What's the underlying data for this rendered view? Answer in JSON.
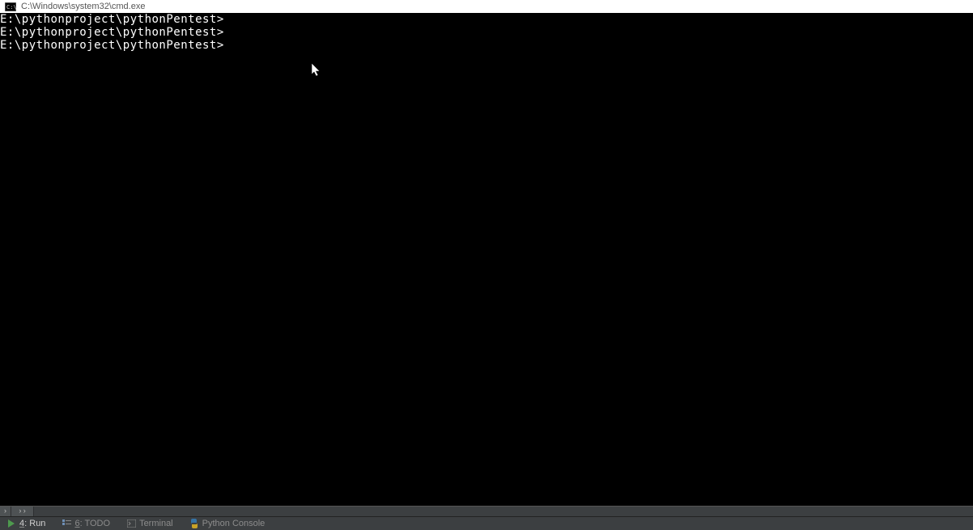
{
  "titlebar": {
    "title": "C:\\Windows\\system32\\cmd.exe"
  },
  "terminal": {
    "lines": [
      "E:\\pythonproject\\pythonPentest>",
      "E:\\pythonproject\\pythonPentest>",
      "E:\\pythonproject\\pythonPentest>"
    ]
  },
  "tabstrip": {
    "collapse1": "›",
    "collapse2": "››"
  },
  "bottombar": {
    "run": {
      "num": "4",
      "label": "Run"
    },
    "todo": {
      "num": "6",
      "label": "TODO"
    },
    "terminal": {
      "label": "Terminal"
    },
    "pyconsole": {
      "label": "Python Console"
    }
  }
}
